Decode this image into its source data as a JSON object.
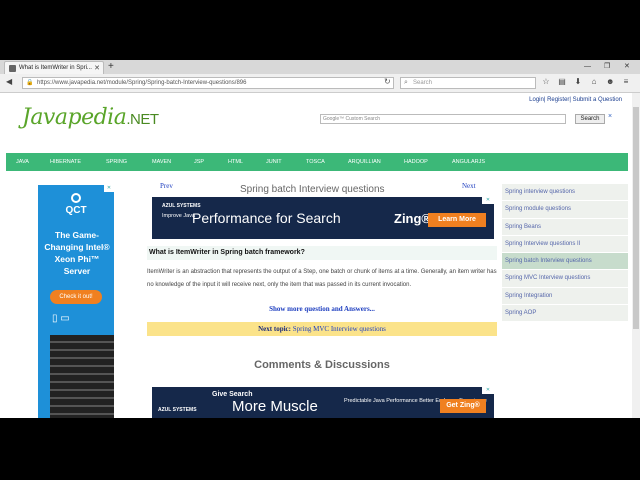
{
  "browser": {
    "tab_title": "What is ItemWriter in Spri...",
    "new_tab_symbol": "+",
    "url": "https://www.javapedia.net/module/Spring/Spring-batch-Interview-questions/896",
    "search_placeholder": "Search"
  },
  "page": {
    "top_links": "Login| Register| Submit a Question",
    "logo_main": "Javapedia",
    "logo_tld": ".NET",
    "google_search_placeholder": "Google™ Custom Search",
    "search_button": "Search",
    "clear_symbol": "×",
    "menu": [
      "JAVA",
      "HIBERNATE",
      "SPRING",
      "MAVEN",
      "JSP",
      "HTML",
      "JUNIT",
      "TOSCA",
      "ARQUILLIAN",
      "HADOOP",
      "ANGULARJS"
    ],
    "prev": "Prev",
    "next": "Next",
    "title": "Spring batch Interview questions",
    "question": "What is ItemWriter in Spring batch framework?",
    "answer": "ItemWriter is an abstraction that represents the output of a Step, one batch or chunk of items at a time. Generally, an item writer has no knowledge of the input it will receive next, only the item that was passed in its current invocation.",
    "show_more": "Show more question and Answers...",
    "next_topic_label": "Next topic:",
    "next_topic_link": "Spring MVC Interview questions",
    "comments_heading": "Comments & Discussions",
    "right_nav": [
      "Spring interview questions",
      "Spring module questions",
      "Spring Beans",
      "Spring Interview questions II",
      "Spring batch Interview questions",
      "Spring MVC Interview questions",
      "Spring Integration",
      "Spring AOP"
    ],
    "right_nav_active_index": 4
  },
  "ads": {
    "left": {
      "brand": "QCT",
      "text": "The Game-Changing Intel® Xeon Phi™ Server",
      "cta": "Check it out!"
    },
    "top_banner": {
      "brand": "AZUL SYSTEMS",
      "small": "Improve Java",
      "headline": "Performance for Search",
      "product": "Zing®",
      "cta": "Learn More"
    },
    "bottom_banner": {
      "brand": "AZUL SYSTEMS",
      "small": "Give Search",
      "headline": "More Muscle",
      "tagline": "Predictable Java Performance Better End-user Experience",
      "cta": "Get Zing®"
    },
    "close_label": "✕"
  },
  "colors": {
    "menu_green": "#3cb878",
    "logo_green": "#5aa52a",
    "link_blue": "#2040c0",
    "next_topic_bg": "#fbe38a",
    "ad_navy": "#15284a",
    "cta_orange": "#f08020"
  }
}
